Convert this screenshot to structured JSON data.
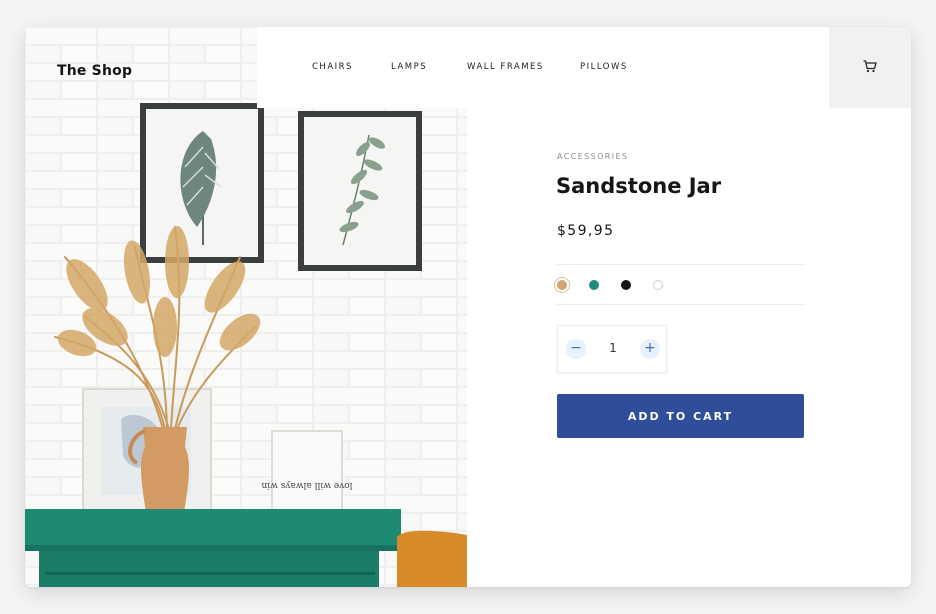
{
  "brand": {
    "name": "The Shop"
  },
  "nav": {
    "items": [
      {
        "label": "CHAIRS"
      },
      {
        "label": "LAMPS"
      },
      {
        "label": "WALL FRAMES"
      },
      {
        "label": "PILLOWS"
      }
    ],
    "cart_icon": "cart-icon"
  },
  "product": {
    "category": "ACCESSORIES",
    "title": "Sandstone Jar",
    "price": "$59,95",
    "colors": [
      {
        "name": "sand",
        "hex": "#d4a373",
        "selected": true
      },
      {
        "name": "teal",
        "hex": "#1f8c7c",
        "selected": false
      },
      {
        "name": "black",
        "hex": "#151515",
        "selected": false
      },
      {
        "name": "white",
        "hex": "#ffffff",
        "selected": false
      }
    ],
    "quantity": "1",
    "minus": "−",
    "plus": "+",
    "add_to_cart": "ADD TO CART"
  },
  "hero": {
    "frame_text": "love will always win"
  },
  "colors": {
    "accent": "#2f4d99",
    "table": "#1e8a73",
    "vase": "#d49a63",
    "brick": "#f3f3f1"
  }
}
